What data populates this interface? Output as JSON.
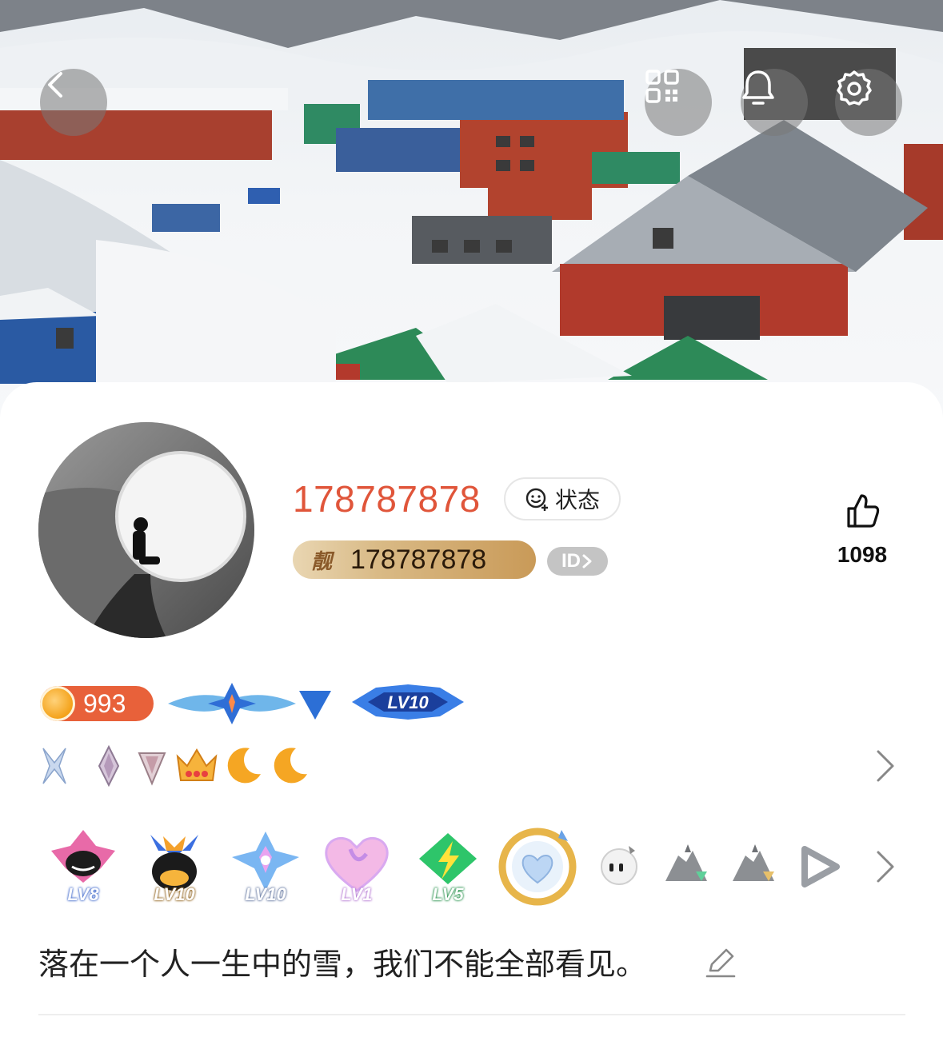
{
  "header": {
    "back_icon": "chevron-left-icon",
    "qr_icon": "qr-code-icon",
    "bell_icon": "bell-icon",
    "settings_icon": "gear-icon"
  },
  "profile": {
    "nickname": "178787878",
    "status_label": "状态",
    "pretty_id_mark": "靓",
    "pretty_id": "178787878",
    "id_chip": "ID",
    "likes": "1098"
  },
  "badges": {
    "coin_value": "993",
    "level_badges": [
      {
        "label": "LV8"
      },
      {
        "label": "LV10"
      },
      {
        "label": "LV10"
      },
      {
        "label": "LV1"
      },
      {
        "label": "LV5"
      }
    ],
    "level_banner": "LV10"
  },
  "signature": "落在一个人一生中的雪，我们不能全部看见。",
  "colors": {
    "nickname": "#e0553a",
    "coin_chip": "#e8613a",
    "pretty_badge": "#d9ba86"
  }
}
